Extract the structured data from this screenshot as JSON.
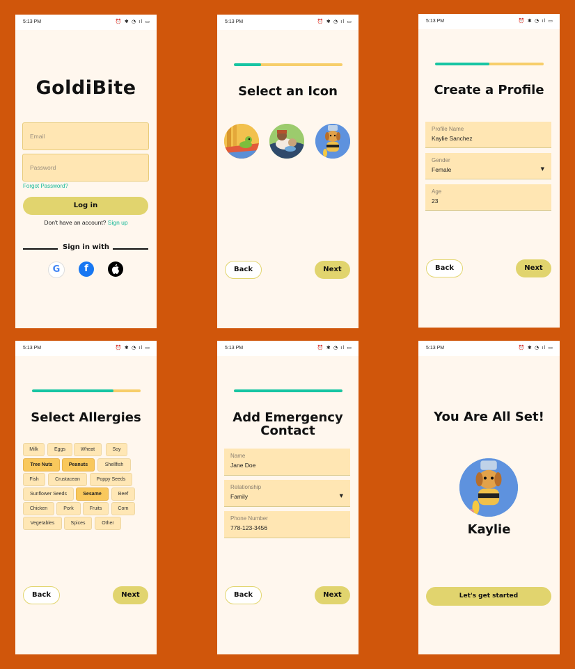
{
  "status": {
    "time": "5:13 PM",
    "icons": "⏰ ✱ ◔ ıl ▭"
  },
  "login": {
    "logo": "GoldiBite",
    "email_placeholder": "Email",
    "password_placeholder": "Password",
    "forgot": "Forgot Password?",
    "login_label": "Log in",
    "no_account": "Don't have an account?",
    "signup": "Sign up",
    "sign_in_with": "Sign in with"
  },
  "icon_screen": {
    "title": "Select an Icon",
    "progress": 0.25
  },
  "profile_screen": {
    "title": "Create a Profile",
    "progress": 0.5,
    "fields": [
      {
        "label": "Profile Name",
        "value": "Kaylie Sanchez"
      },
      {
        "label": "Gender",
        "value": "Female"
      },
      {
        "label": "Age",
        "value": "23"
      }
    ]
  },
  "allergy_screen": {
    "title": "Select Allergies",
    "progress": 0.75,
    "chips": [
      {
        "label": "Milk",
        "selected": false
      },
      {
        "label": "Eggs",
        "selected": false
      },
      {
        "label": "Wheat",
        "selected": false
      },
      {
        "label": "Soy",
        "selected": false
      },
      {
        "label": "Tree Nuts",
        "selected": true
      },
      {
        "label": "Peanuts",
        "selected": true
      },
      {
        "label": "Shellfish",
        "selected": false
      },
      {
        "label": "Fish",
        "selected": false
      },
      {
        "label": "Crustacean",
        "selected": false
      },
      {
        "label": "Poppy Seeds",
        "selected": false
      },
      {
        "label": "Sunflower Seeds",
        "selected": false
      },
      {
        "label": "Sesame",
        "selected": true
      },
      {
        "label": "Beef",
        "selected": false
      },
      {
        "label": "Chicken",
        "selected": false
      },
      {
        "label": "Pork",
        "selected": false
      },
      {
        "label": "Fruits",
        "selected": false
      },
      {
        "label": "Corn",
        "selected": false
      },
      {
        "label": "Vegetables",
        "selected": false
      },
      {
        "label": "Spices",
        "selected": false
      },
      {
        "label": "Other",
        "selected": false
      }
    ]
  },
  "emergency_screen": {
    "title_line1": "Add Emergency",
    "title_line2": "Contact",
    "progress": 1.0,
    "fields": [
      {
        "label": "Name",
        "value": "Jane Doe"
      },
      {
        "label": "Relationship",
        "value": "Family"
      },
      {
        "label": "Phone Number",
        "value": "778-123-3456"
      }
    ]
  },
  "done_screen": {
    "title": "You Are All Set!",
    "name": "Kaylie",
    "cta": "Let's get started"
  },
  "nav": {
    "back": "Back",
    "next": "Next"
  },
  "colors": {
    "background": "#D0560B",
    "screen": "#FFF7EE",
    "accent": "#E1D46E",
    "teal": "#17C5A3",
    "field": "#FFE6B3"
  }
}
